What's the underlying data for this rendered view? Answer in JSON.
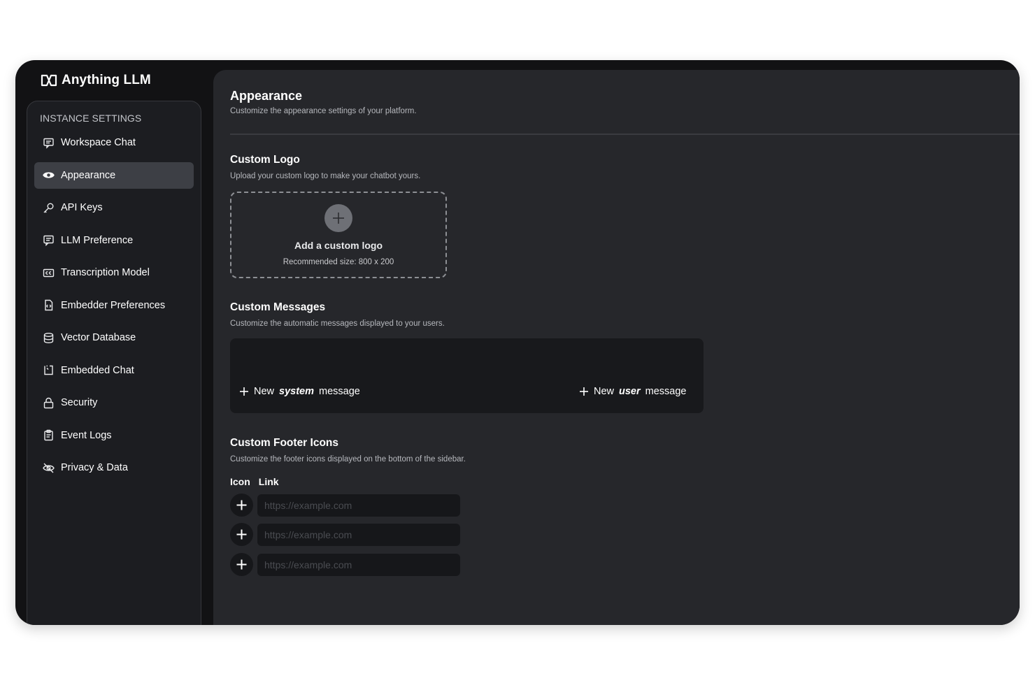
{
  "app": {
    "brand": "Anything LLM"
  },
  "sidebar": {
    "heading": "INSTANCE SETTINGS",
    "items": [
      {
        "label": "Workspace Chat",
        "icon": "chat-icon"
      },
      {
        "label": "Appearance",
        "icon": "eye-icon",
        "active": true
      },
      {
        "label": "API Keys",
        "icon": "key-icon"
      },
      {
        "label": "LLM Preference",
        "icon": "message-icon"
      },
      {
        "label": "Transcription Model",
        "icon": "closed-caption-icon"
      },
      {
        "label": "Embedder Preferences",
        "icon": "file-code-icon"
      },
      {
        "label": "Vector Database",
        "icon": "database-icon"
      },
      {
        "label": "Embedded Chat",
        "icon": "embed-icon"
      },
      {
        "label": "Security",
        "icon": "lock-icon"
      },
      {
        "label": "Event Logs",
        "icon": "clipboard-icon"
      },
      {
        "label": "Privacy & Data",
        "icon": "eye-slash-icon"
      }
    ]
  },
  "page": {
    "title": "Appearance",
    "subtitle": "Customize the appearance settings of your platform."
  },
  "custom_logo": {
    "title": "Custom Logo",
    "description": "Upload your custom logo to make your chatbot yours.",
    "drop_title": "Add a custom logo",
    "drop_hint": "Recommended size: 800 x 200"
  },
  "custom_messages": {
    "title": "Custom Messages",
    "description": "Customize the automatic messages displayed to your users.",
    "system_btn": {
      "prefix": "New",
      "emphasis": "system",
      "suffix": "message"
    },
    "user_btn": {
      "prefix": "New",
      "emphasis": "user",
      "suffix": "message"
    }
  },
  "footer_icons": {
    "title": "Custom Footer Icons",
    "description": "Customize the footer icons displayed on the bottom of the sidebar.",
    "col_icon": "Icon",
    "col_link": "Link",
    "rows": [
      {
        "placeholder": "https://example.com",
        "value": ""
      },
      {
        "placeholder": "https://example.com",
        "value": ""
      },
      {
        "placeholder": "https://example.com",
        "value": ""
      }
    ]
  },
  "colors": {
    "window_bg": "#121214",
    "sidebar_bg": "#1c1d21",
    "main_bg": "#26272b",
    "active_item_bg": "#3d3f45",
    "panel_bg": "#18191c"
  }
}
